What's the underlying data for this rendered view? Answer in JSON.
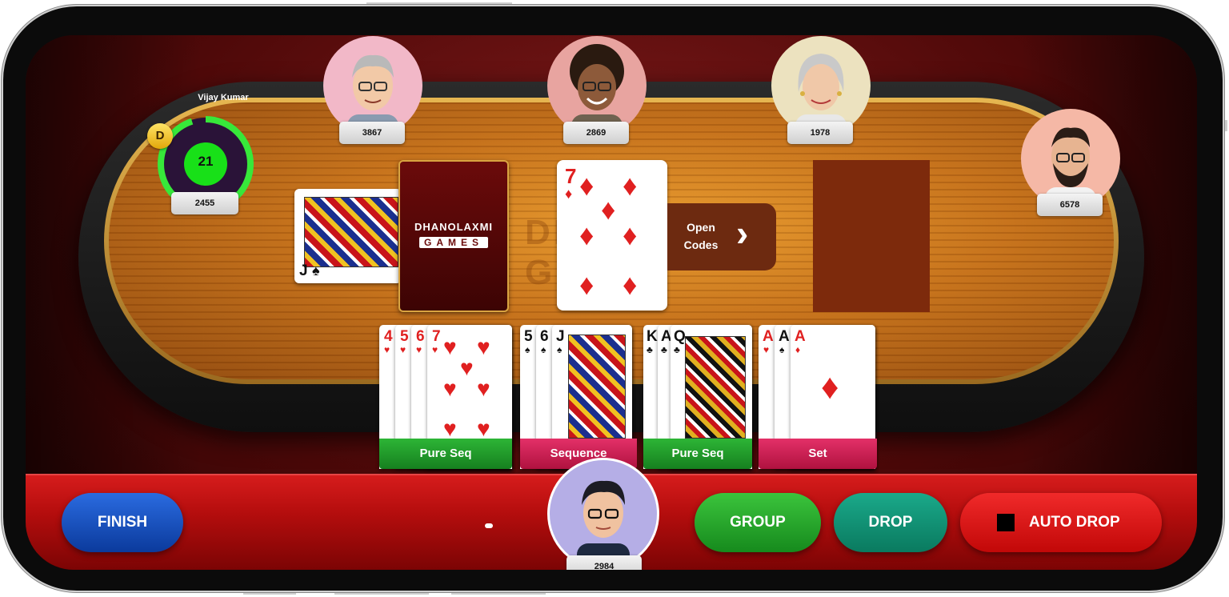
{
  "player": {
    "name": "Vijay Kumar",
    "dealer_badge": "D",
    "timer": "21",
    "score": "2455",
    "timer_fraction": 0.95
  },
  "opponents": [
    {
      "score": "3867"
    },
    {
      "score": "2869"
    },
    {
      "score": "1978"
    },
    {
      "score": "6578"
    }
  ],
  "self": {
    "score": "2984"
  },
  "deck": {
    "brand_line1": "DHANOLAXMI",
    "brand_line2": "GAMES"
  },
  "joker_card": {
    "rank": "J"
  },
  "open_card": {
    "rank": "7",
    "suit": "♦"
  },
  "open_codes": {
    "line1": "Open",
    "line2": "Codes",
    "chevron": "›"
  },
  "groups": [
    {
      "label": "Pure Seq",
      "cards": [
        "4",
        "5",
        "6",
        "7"
      ],
      "suit": "♥"
    },
    {
      "label": "Sequence",
      "cards": [
        "5",
        "6",
        "J"
      ],
      "suit": "♠"
    },
    {
      "label": "Pure Seq",
      "cards": [
        "K",
        "A",
        "Q"
      ],
      "suit": "♣"
    },
    {
      "label": "Set",
      "cards": [
        "A",
        "A",
        "A"
      ],
      "suits": [
        "♥",
        "♠",
        "♦"
      ]
    }
  ],
  "buttons": {
    "finish": "FINISH",
    "group": "GROUP",
    "drop": "DROP",
    "auto_drop": "AUTO DROP"
  },
  "colors": {
    "finish": "#1147b3",
    "group": "#22a32a",
    "drop": "#0f8f6f",
    "auto_drop": "#e01010",
    "pure_seq": "#1f9a2a",
    "sequence": "#d21a55"
  }
}
